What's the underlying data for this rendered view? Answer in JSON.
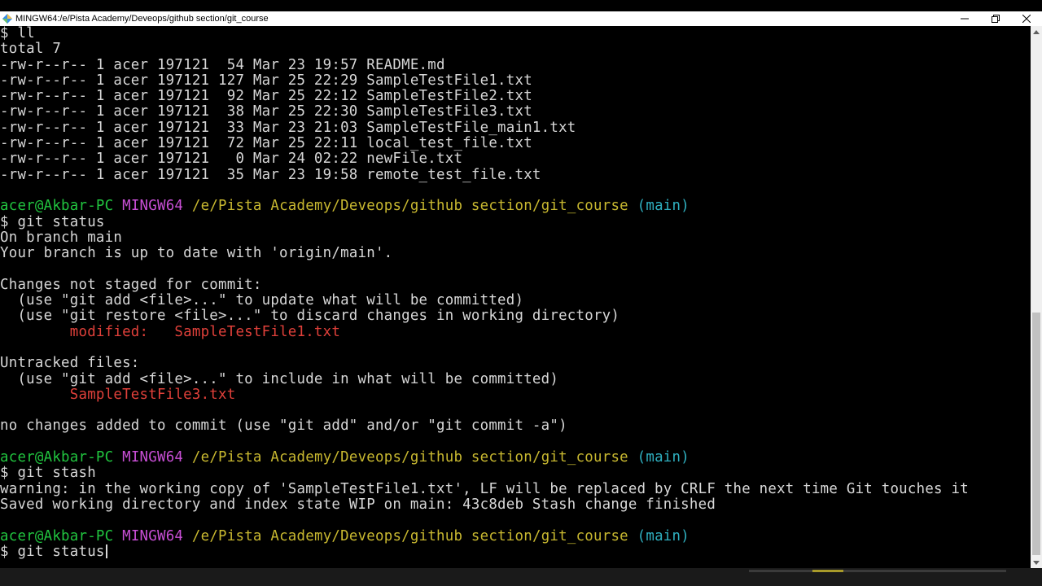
{
  "window": {
    "title": "MINGW64:/e/Pista Academy/Deveops/github section/git_course",
    "icon": "mingw-diamond-icon"
  },
  "terminal": {
    "cmd_ll": "$ ll",
    "total": "total 7",
    "files": [
      "-rw-r--r-- 1 acer 197121  54 Mar 23 19:57 README.md",
      "-rw-r--r-- 1 acer 197121 127 Mar 25 22:29 SampleTestFile1.txt",
      "-rw-r--r-- 1 acer 197121  92 Mar 25 22:12 SampleTestFile2.txt",
      "-rw-r--r-- 1 acer 197121  38 Mar 25 22:30 SampleTestFile3.txt",
      "-rw-r--r-- 1 acer 197121  33 Mar 23 21:03 SampleTestFile_main1.txt",
      "-rw-r--r-- 1 acer 197121  72 Mar 25 22:11 local_test_file.txt",
      "-rw-r--r-- 1 acer 197121   0 Mar 24 02:22 newFile.txt",
      "-rw-r--r-- 1 acer 197121  35 Mar 23 19:58 remote_test_file.txt"
    ],
    "prompt": {
      "user_host": "acer@Akbar-PC",
      "env": "MINGW64",
      "path": "/e/Pista Academy/Deveops/github section/git_course",
      "branch": "(main)"
    },
    "cmd_status": "$ git status",
    "status_output": {
      "on_branch": "On branch main",
      "up_to_date": "Your branch is up to date with 'origin/main'.",
      "not_staged_header": "Changes not staged for commit:",
      "hint_add": "  (use \"git add <file>...\" to update what will be committed)",
      "hint_restore": "  (use \"git restore <file>...\" to discard changes in working directory)",
      "modified_label": "        modified:   ",
      "modified_file": "SampleTestFile1.txt",
      "untracked_header": "Untracked files:",
      "hint_untracked": "  (use \"git add <file>...\" to include in what will be committed)",
      "untracked_file": "SampleTestFile3.txt",
      "no_changes": "no changes added to commit (use \"git add\" and/or \"git commit -a\")"
    },
    "cmd_stash": "$ git stash",
    "stash_output": {
      "warning": "warning: in the working copy of 'SampleTestFile1.txt', LF will be replaced by CRLF the next time Git touches it",
      "saved": "Saved working directory and index state WIP on main: 43c8deb Stash change finished"
    },
    "current_input": "$ git status"
  },
  "colors": {
    "prompt_user": "#21c43f",
    "prompt_env": "#c94fd6",
    "prompt_path": "#c8b830",
    "prompt_branch": "#2fb0c0",
    "git_red": "#e0403a",
    "text": "#d7d7d7",
    "background": "#000000"
  }
}
